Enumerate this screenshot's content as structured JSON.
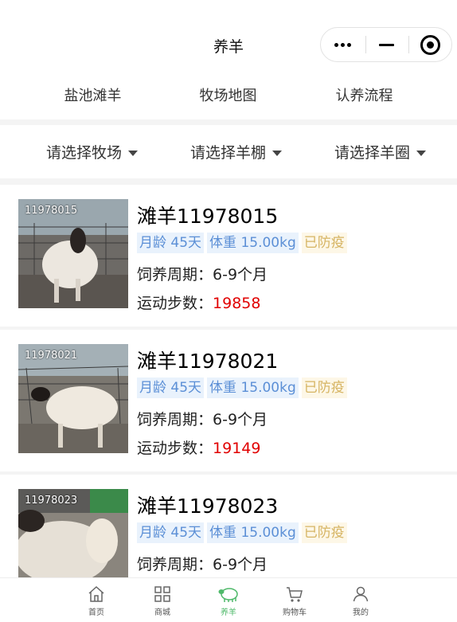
{
  "nav": {
    "title": "养羊"
  },
  "tabs": [
    "盐池滩羊",
    "牧场地图",
    "认养流程"
  ],
  "filters": [
    "请选择牧场",
    "请选择羊棚",
    "请选择羊圈"
  ],
  "sheep": [
    {
      "tag": "11978015",
      "name": "滩羊11978015",
      "age": "月龄 45天",
      "weight": "体重 15.00kg",
      "status": "已防疫",
      "period_label": "饲养周期：",
      "period": "6-9个月",
      "steps_label": "运动步数：",
      "steps": "19858"
    },
    {
      "tag": "11978021",
      "name": "滩羊11978021",
      "age": "月龄 45天",
      "weight": "体重 15.00kg",
      "status": "已防疫",
      "period_label": "饲养周期：",
      "period": "6-9个月",
      "steps_label": "运动步数：",
      "steps": "19149"
    },
    {
      "tag": "11978023",
      "name": "滩羊11978023",
      "age": "月龄 45天",
      "weight": "体重 15.00kg",
      "status": "已防疫",
      "period_label": "饲养周期：",
      "period": "6-9个月",
      "steps_label": "",
      "steps": ""
    }
  ],
  "tabbar": [
    {
      "label": "首页",
      "icon": "home-icon"
    },
    {
      "label": "商城",
      "icon": "grid-icon"
    },
    {
      "label": "养羊",
      "icon": "sheep-icon",
      "active": true
    },
    {
      "label": "购物车",
      "icon": "cart-icon"
    },
    {
      "label": "我的",
      "icon": "user-icon"
    }
  ],
  "colors": {
    "accent": "#4fb96a",
    "steps": "#e10000",
    "chip_blue": "#5b8fd6",
    "chip_yellow": "#d6b463"
  }
}
